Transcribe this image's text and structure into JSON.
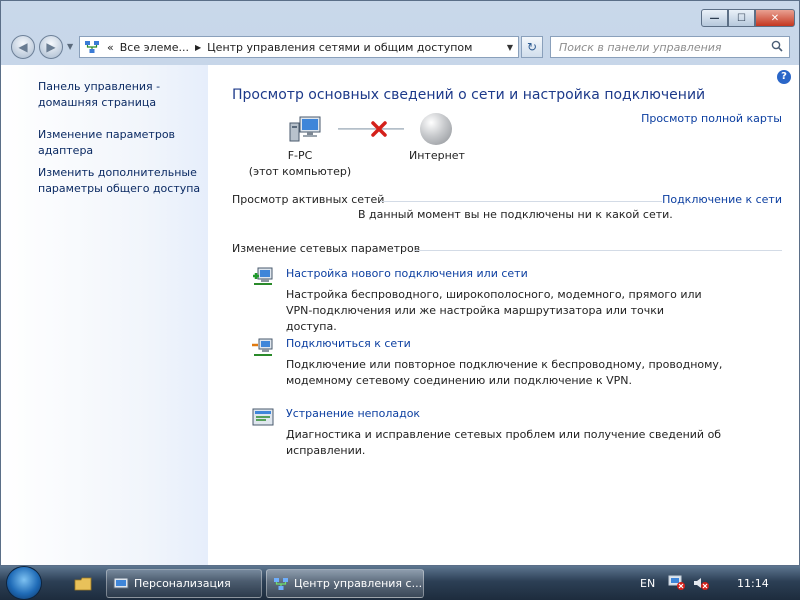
{
  "window": {
    "caption": {
      "minimize": "—",
      "maximize": "☐",
      "close": "✕"
    }
  },
  "nav": {
    "back_glyph": "◀",
    "forward_glyph": "▶",
    "address": {
      "overflow": "«",
      "crumb_1": "Все элеме...",
      "separator": "▶",
      "crumb_2": "Центр управления сетями и общим доступом"
    },
    "refresh_glyph": "↻",
    "search": {
      "placeholder": "Поиск в панели управления"
    }
  },
  "sidebar": {
    "items": [
      {
        "label": "Панель управления - домашняя страница"
      },
      {
        "label": "Изменение параметров адаптера"
      },
      {
        "label": "Изменить дополнительные параметры общего доступа"
      }
    ]
  },
  "main": {
    "help": "?",
    "title": "Просмотр основных сведений о сети и настройка подключений",
    "full_map_link": "Просмотр полной карты",
    "computer": {
      "name": "F-PC",
      "subtitle": "(этот компьютер)"
    },
    "internet_label": "Интернет",
    "active_networks": {
      "heading": "Просмотр активных сетей",
      "connect_link": "Подключение к сети",
      "status": "В данный момент вы не подключены ни к какой сети."
    },
    "change_settings": {
      "heading": "Изменение сетевых параметров",
      "tasks": [
        {
          "link": "Настройка нового подключения или сети",
          "desc": "Настройка беспроводного, широкополосного, модемного, прямого или VPN-подключения или же настройка маршрутизатора или точки доступа."
        },
        {
          "link": "Подключиться к сети",
          "desc": "Подключение или повторное подключение к беспроводному, проводному, модемному сетевому соединению или подключение к VPN."
        },
        {
          "link": "Устранение неполадок",
          "desc": "Диагностика и исправление сетевых проблем или получение сведений об исправлении."
        }
      ]
    }
  },
  "taskbar": {
    "tasks": [
      {
        "label": "Персонализация"
      },
      {
        "label": "Центр управления с..."
      }
    ],
    "language": "EN",
    "clock": "11:14"
  },
  "colors": {
    "link": "#0b3ea0",
    "title": "#1d3a8a",
    "close_button": "#c4361f",
    "error_x": "#d4201a"
  }
}
